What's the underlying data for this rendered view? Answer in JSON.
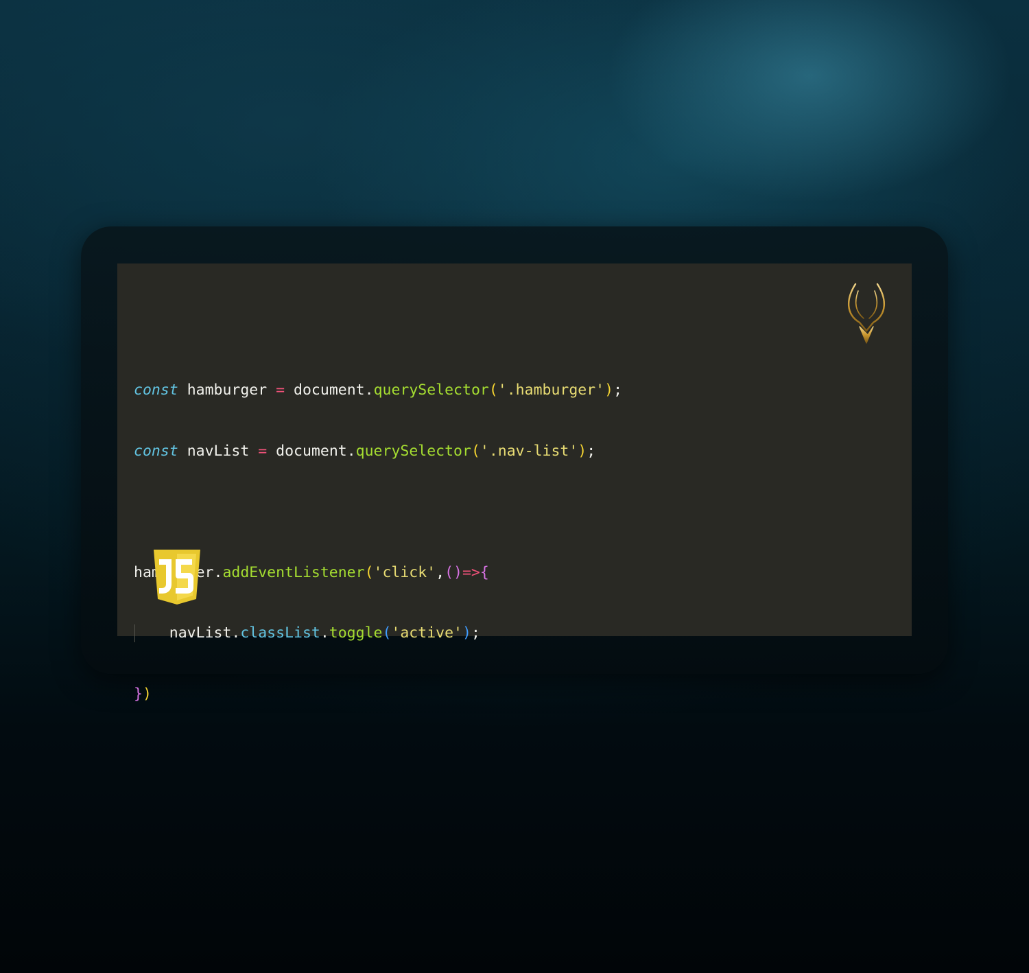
{
  "code": {
    "line1": {
      "keyword": "const",
      "variable": "hamburger",
      "operator": "=",
      "object": "document",
      "method": "querySelector",
      "string": "'.hamburger'"
    },
    "line2": {
      "keyword": "const",
      "variable": "navList",
      "operator": "=",
      "object": "document",
      "method": "querySelector",
      "string": "'.nav-list'"
    },
    "line4": {
      "object": "hamburger",
      "method": "addEventListener",
      "string": "'click'",
      "arrow": "=>"
    },
    "line5": {
      "object": "navList",
      "property": "classList",
      "method": "toggle",
      "string": "'active'"
    }
  },
  "icons": {
    "brand_logo": "antler-logo-icon",
    "language": "javascript-shield-icon"
  },
  "colors": {
    "editor_background": "#292924",
    "keyword": "#62c4e2",
    "operator": "#f2527a",
    "function": "#a5dd31",
    "string": "#e8dc73",
    "js_yellow": "#e8c82e"
  }
}
